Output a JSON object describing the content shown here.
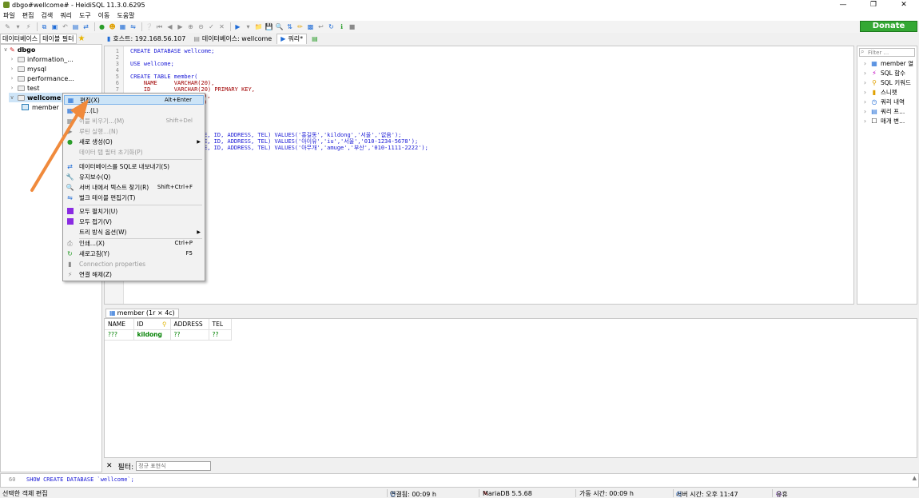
{
  "window": {
    "title": "dbgo#wellcome# - HeidiSQL 11.3.0.6295"
  },
  "menu": [
    "파일",
    "편집",
    "검색",
    "쿼리",
    "도구",
    "이동",
    "도움말"
  ],
  "donate": "Donate",
  "left_tabs": [
    "데이터베이스",
    "테이블 필터"
  ],
  "main_tabs": {
    "host": "호스트: 192.168.56.107",
    "database": "데이터베이스: wellcome",
    "query": "쿼리*"
  },
  "tree": {
    "root": "dbgo",
    "items": [
      "information_...",
      "mysql",
      "performance...",
      "test",
      "wellcome"
    ],
    "table": "member"
  },
  "editor": {
    "lines": [
      {
        "n": "1",
        "t": "CREATE DATABASE wellcome;"
      },
      {
        "n": "2",
        "t": ""
      },
      {
        "n": "3",
        "t": "USE wellcome;"
      },
      {
        "n": "4",
        "t": ""
      },
      {
        "n": "5",
        "t": "CREATE TABLE member("
      },
      {
        "n": "6",
        "t": "    NAME     VARCHAR(20),"
      },
      {
        "n": "7",
        "t": "    ID       VARCHAR(20) PRIMARY KEY,"
      },
      {
        "n": "8",
        "t": "),"
      },
      {
        "n": "9",
        "t": ")"
      },
      {
        "n": "10",
        "t": ""
      },
      {
        "n": "11",
        "t": ""
      },
      {
        "n": "12",
        "t": ""
      },
      {
        "n": "13",
        "t": "E, ID, ADDRESS, TEL) VALUES('홍길동','kildong','서울','없음');"
      },
      {
        "n": "14",
        "t": "E, ID, ADDRESS, TEL) VALUES('아이유','iu','서울','010-1234-5678');"
      },
      {
        "n": "15",
        "t": "E, ID, ADDRESS, TEL) VALUES('아무개','amuge','부산','010-1111-2222');"
      }
    ]
  },
  "helper": {
    "filter_placeholder": "Filter ...",
    "items": [
      "member 열",
      "SQL 함수",
      "SQL 키워드",
      "스니펫",
      "쿼리 내역",
      "쿼리 프...",
      "매개 변..."
    ]
  },
  "context_menu": {
    "items": [
      {
        "label": "편집(X)",
        "shortcut": "Alt+Enter",
        "state": "highlighted"
      },
      {
        "label": "제...(L)",
        "shortcut": "",
        "state": "normal"
      },
      {
        "label": "이블 비우기...(M)",
        "shortcut": "Shift+Del",
        "state": "disabled"
      },
      {
        "label": "루틴 실행...(N)",
        "shortcut": "",
        "state": "disabled"
      },
      {
        "label": "새로 생성(O)",
        "shortcut": "",
        "state": "submenu"
      },
      {
        "label": "데이터 탭 필터 초기화(P)",
        "shortcut": "",
        "state": "disabled"
      },
      {
        "label": "데이터베이스를 SQL로 내보내기(S)",
        "shortcut": "",
        "state": "normal"
      },
      {
        "label": "유지보수(Q)",
        "shortcut": "",
        "state": "normal"
      },
      {
        "label": "서버 내에서 텍스트 찾기(R)",
        "shortcut": "Shift+Ctrl+F",
        "state": "normal"
      },
      {
        "label": "벌크 테이블 편집기(T)",
        "shortcut": "",
        "state": "normal"
      },
      {
        "label": "모두 펼치기(U)",
        "shortcut": "",
        "state": "normal"
      },
      {
        "label": "모두 접기(V)",
        "shortcut": "",
        "state": "normal"
      },
      {
        "label": "트리 방식 옵션(W)",
        "shortcut": "",
        "state": "submenu"
      },
      {
        "label": "인쇄...(X)",
        "shortcut": "Ctrl+P",
        "state": "normal"
      },
      {
        "label": "새로고침(Y)",
        "shortcut": "F5",
        "state": "normal"
      },
      {
        "label": "Connection properties",
        "shortcut": "",
        "state": "disabled"
      },
      {
        "label": "연결 해제(Z)",
        "shortcut": "",
        "state": "normal"
      }
    ]
  },
  "results": {
    "tab": "member (1r × 4c)",
    "columns": [
      "NAME",
      "ID",
      "ADDRESS",
      "TEL"
    ],
    "rows": [
      [
        "???",
        "kildong",
        "??",
        "??"
      ]
    ]
  },
  "filter": {
    "label": "필터:",
    "placeholder": "정규 표현식"
  },
  "log": {
    "num": "60",
    "text": "SHOW CREATE DATABASE `wellcome`;"
  },
  "status": {
    "left": "선택한 객체 편집",
    "connected": "연결됨: 00:09 h",
    "server": "MariaDB 5.5.68",
    "uptime": "가동 시간: 00:09 h",
    "server_time": "서버 시간: 오후 11:47",
    "idle": "유휴"
  },
  "colors": {
    "accent": "#34a834",
    "selection": "#cce4f7",
    "arrow": "#f08a3c"
  }
}
